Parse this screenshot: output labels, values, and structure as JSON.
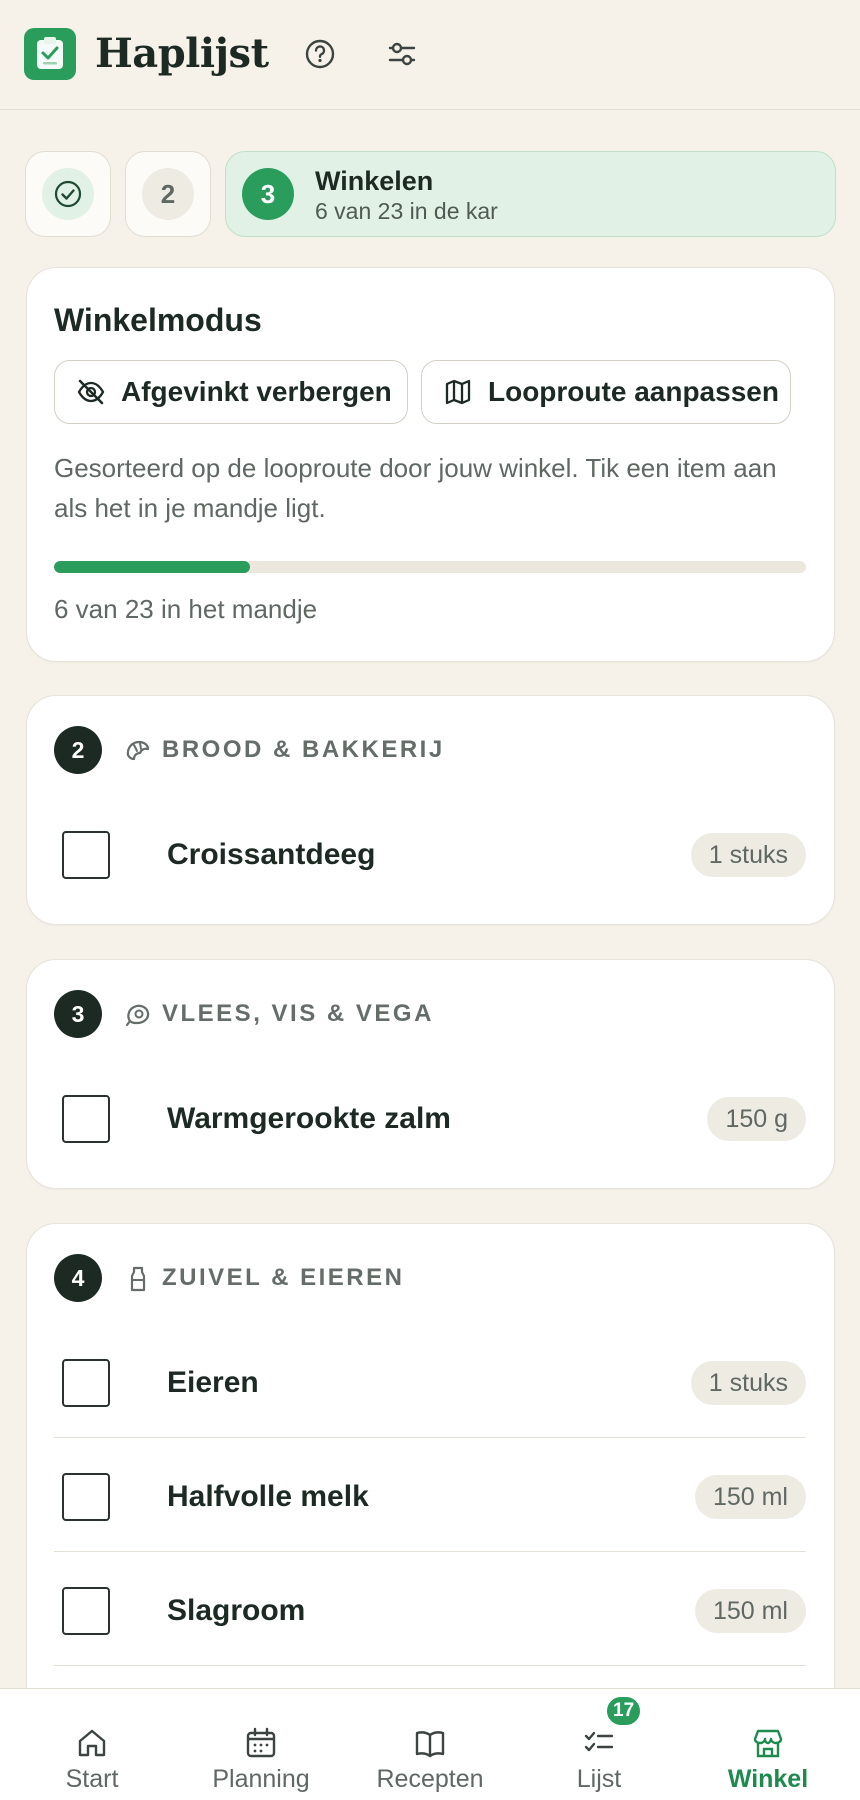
{
  "app": {
    "title": "Haplijst"
  },
  "steps": [
    {
      "number": "",
      "state": "done"
    },
    {
      "number": "2",
      "state": "pending"
    },
    {
      "number": "3",
      "state": "active",
      "title": "Winkelen",
      "subtitle": "6 van 23 in de kar"
    }
  ],
  "shop_mode": {
    "title": "Winkelmodus",
    "hide_checked_label": "Afgevinkt verbergen",
    "edit_route_label": "Looproute aanpassen",
    "description": "Gesorteerd op de looproute door jouw winkel. Tik een item aan als het in je mandje ligt.",
    "progress_fraction": 0.26,
    "progress_text": "6 van 23 in het mandje"
  },
  "sections": [
    {
      "number": "2",
      "title": "BROOD & BAKKERIJ",
      "icon": "croissant-icon",
      "items": [
        {
          "name": "Croissantdeeg",
          "qty": "1 stuks"
        }
      ]
    },
    {
      "number": "3",
      "title": "VLEES, VIS & VEGA",
      "icon": "meat-icon",
      "items": [
        {
          "name": "Warmgerookte zalm",
          "qty": "150 g"
        }
      ]
    },
    {
      "number": "4",
      "title": "ZUIVEL & EIEREN",
      "icon": "milk-bottle-icon",
      "items": [
        {
          "name": "Eieren",
          "qty": "1 stuks"
        },
        {
          "name": "Halfvolle melk",
          "qty": "150 ml"
        },
        {
          "name": "Slagroom",
          "qty": "150 ml"
        }
      ]
    }
  ],
  "nav": {
    "items": [
      {
        "label": "Start",
        "icon": "home-icon"
      },
      {
        "label": "Planning",
        "icon": "calendar-icon"
      },
      {
        "label": "Recepten",
        "icon": "book-icon"
      },
      {
        "label": "Lijst",
        "icon": "checklist-icon",
        "badge": "17"
      },
      {
        "label": "Winkel",
        "icon": "store-icon",
        "active": true
      }
    ]
  },
  "colors": {
    "accent": "#2a9d5c",
    "background": "#f6f2ea",
    "dark": "#1d2a24"
  }
}
